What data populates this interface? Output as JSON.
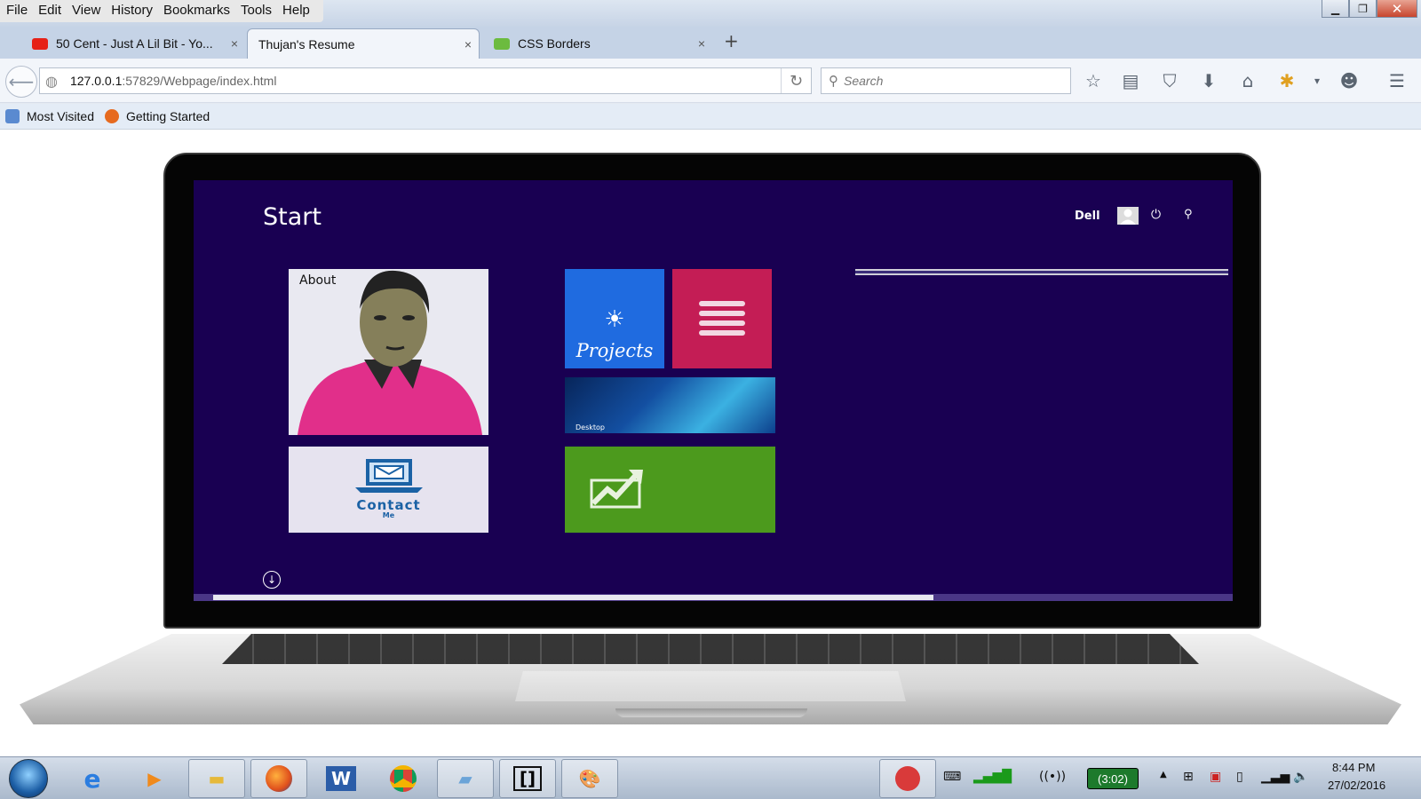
{
  "menu": [
    "File",
    "Edit",
    "View",
    "History",
    "Bookmarks",
    "Tools",
    "Help"
  ],
  "window_controls": {
    "minimize": "▁",
    "maximize": "❐",
    "close": "✕"
  },
  "tabs": [
    {
      "title": "50 Cent - Just A Lil Bit - Yo...",
      "active": false,
      "favicon_color": "#e62117",
      "close": "×"
    },
    {
      "title": "Thujan's Resume",
      "active": true,
      "favicon_color": "",
      "close": "×"
    },
    {
      "title": "CSS Borders",
      "active": false,
      "favicon_color": "#6cbb3f",
      "close": "×"
    }
  ],
  "new_tab": "+",
  "url": {
    "host": "127.0.0.1",
    "rest": ":57829/Webpage/index.html"
  },
  "search": {
    "placeholder": "Search"
  },
  "bookmarks": [
    "Most Visited",
    "Getting Started"
  ],
  "page": {
    "start_title": "Start",
    "user_name": "Dell",
    "tiles": {
      "about": "About",
      "contact": "Contact",
      "contact_sub": "Me",
      "projects": "Projects",
      "desktop": "Desktop"
    },
    "scroll_position": 0.72,
    "colors": {
      "screen": "#190052",
      "projects": "#1f6be0",
      "notes": "#c41d55",
      "finance": "#4c9a1d"
    }
  },
  "taskbar": {
    "battery": "(3:02)",
    "time": "8:44 PM",
    "date": "27/02/2016",
    "apps": [
      "internet-explorer-icon",
      "media-player-icon",
      "file-explorer-icon",
      "firefox-icon",
      "word-icon",
      "chrome-icon",
      "notepad-icon",
      "brackets-icon",
      "paint-icon"
    ]
  }
}
